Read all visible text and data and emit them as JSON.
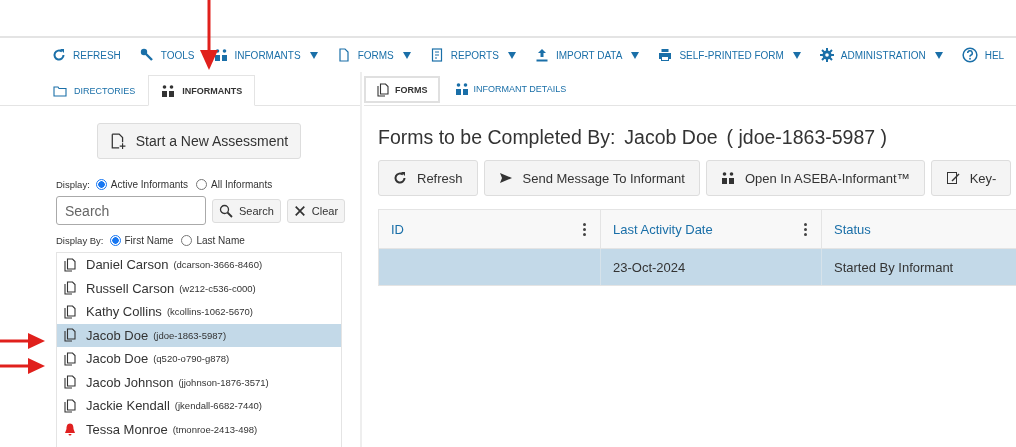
{
  "toolbar": [
    {
      "label": "REFRESH",
      "kind": "refresh",
      "dropdown": false
    },
    {
      "label": "TOOLS",
      "kind": "wrench",
      "dropdown": false
    },
    {
      "label": "INFORMANTS",
      "kind": "people",
      "dropdown": true
    },
    {
      "label": "FORMS",
      "kind": "doc",
      "dropdown": true
    },
    {
      "label": "REPORTS",
      "kind": "report",
      "dropdown": true
    },
    {
      "label": "IMPORT DATA",
      "kind": "upload",
      "dropdown": true
    },
    {
      "label": "SELF-PRINTED FORM",
      "kind": "printer",
      "dropdown": true
    },
    {
      "label": "ADMINISTRATION",
      "kind": "gear",
      "dropdown": true
    },
    {
      "label": "HEL",
      "kind": "help",
      "dropdown": false
    }
  ],
  "left_tabs": [
    {
      "label": "DIRECTORIES",
      "kind": "folder",
      "selected": false
    },
    {
      "label": "INFORMANTS",
      "kind": "people",
      "selected": true
    }
  ],
  "new_assessment_button": "Start a New Assessment",
  "display": {
    "label": "Display:",
    "options": [
      {
        "label": "Active Informants",
        "selected": true
      },
      {
        "label": "All Informants",
        "selected": false
      }
    ]
  },
  "search": {
    "placeholder": "Search",
    "search_button": "Search",
    "clear_button": "Clear"
  },
  "display_by": {
    "label": "Display By:",
    "options": [
      {
        "label": "First Name",
        "selected": true
      },
      {
        "label": "Last Name",
        "selected": false
      }
    ]
  },
  "informants": [
    {
      "name": "Daniel Carson",
      "id": "(dcarson-3666-8460)",
      "kind": "forms",
      "selected": false
    },
    {
      "name": "Russell Carson",
      "id": "(w212-c536-c000)",
      "kind": "forms",
      "selected": false
    },
    {
      "name": "Kathy Collins",
      "id": "(kcollins-1062-5670)",
      "kind": "forms",
      "selected": false
    },
    {
      "name": "Jacob Doe",
      "id": "(jdoe-1863-5987)",
      "kind": "forms",
      "selected": true
    },
    {
      "name": "Jacob Doe",
      "id": "(q520-o790-g878)",
      "kind": "forms",
      "selected": false
    },
    {
      "name": "Jacob Johnson",
      "id": "(jjohnson-1876-3571)",
      "kind": "forms",
      "selected": false
    },
    {
      "name": "Jackie Kendall",
      "id": "(jkendall-6682-7440)",
      "kind": "forms",
      "selected": false
    },
    {
      "name": "Tessa Monroe",
      "id": "(tmonroe-2413-498)",
      "kind": "alert",
      "selected": false
    }
  ],
  "right_tabs": [
    {
      "label": "FORMS",
      "kind": "docs",
      "selected": true
    },
    {
      "label": "INFORMANT DETAILS",
      "kind": "people",
      "selected": false
    }
  ],
  "heading": {
    "label": "Forms to be Completed By:",
    "name": "Jacob Doe",
    "id": "( jdoe-1863-5987 )"
  },
  "actions": [
    {
      "label": "Refresh",
      "kind": "refresh"
    },
    {
      "label": "Send Message To Informant",
      "kind": "send"
    },
    {
      "label": "Open In ASEBA-Informant™",
      "kind": "people"
    },
    {
      "label": "Key-",
      "kind": "edit"
    }
  ],
  "table": {
    "columns": [
      {
        "label": "ID",
        "menu": true
      },
      {
        "label": "Last Activity Date",
        "menu": true
      },
      {
        "label": "Status",
        "menu": false
      }
    ],
    "rows": [
      {
        "cells": [
          "",
          "23-Oct-2024",
          "Started By Informant"
        ],
        "selected": true
      }
    ]
  }
}
